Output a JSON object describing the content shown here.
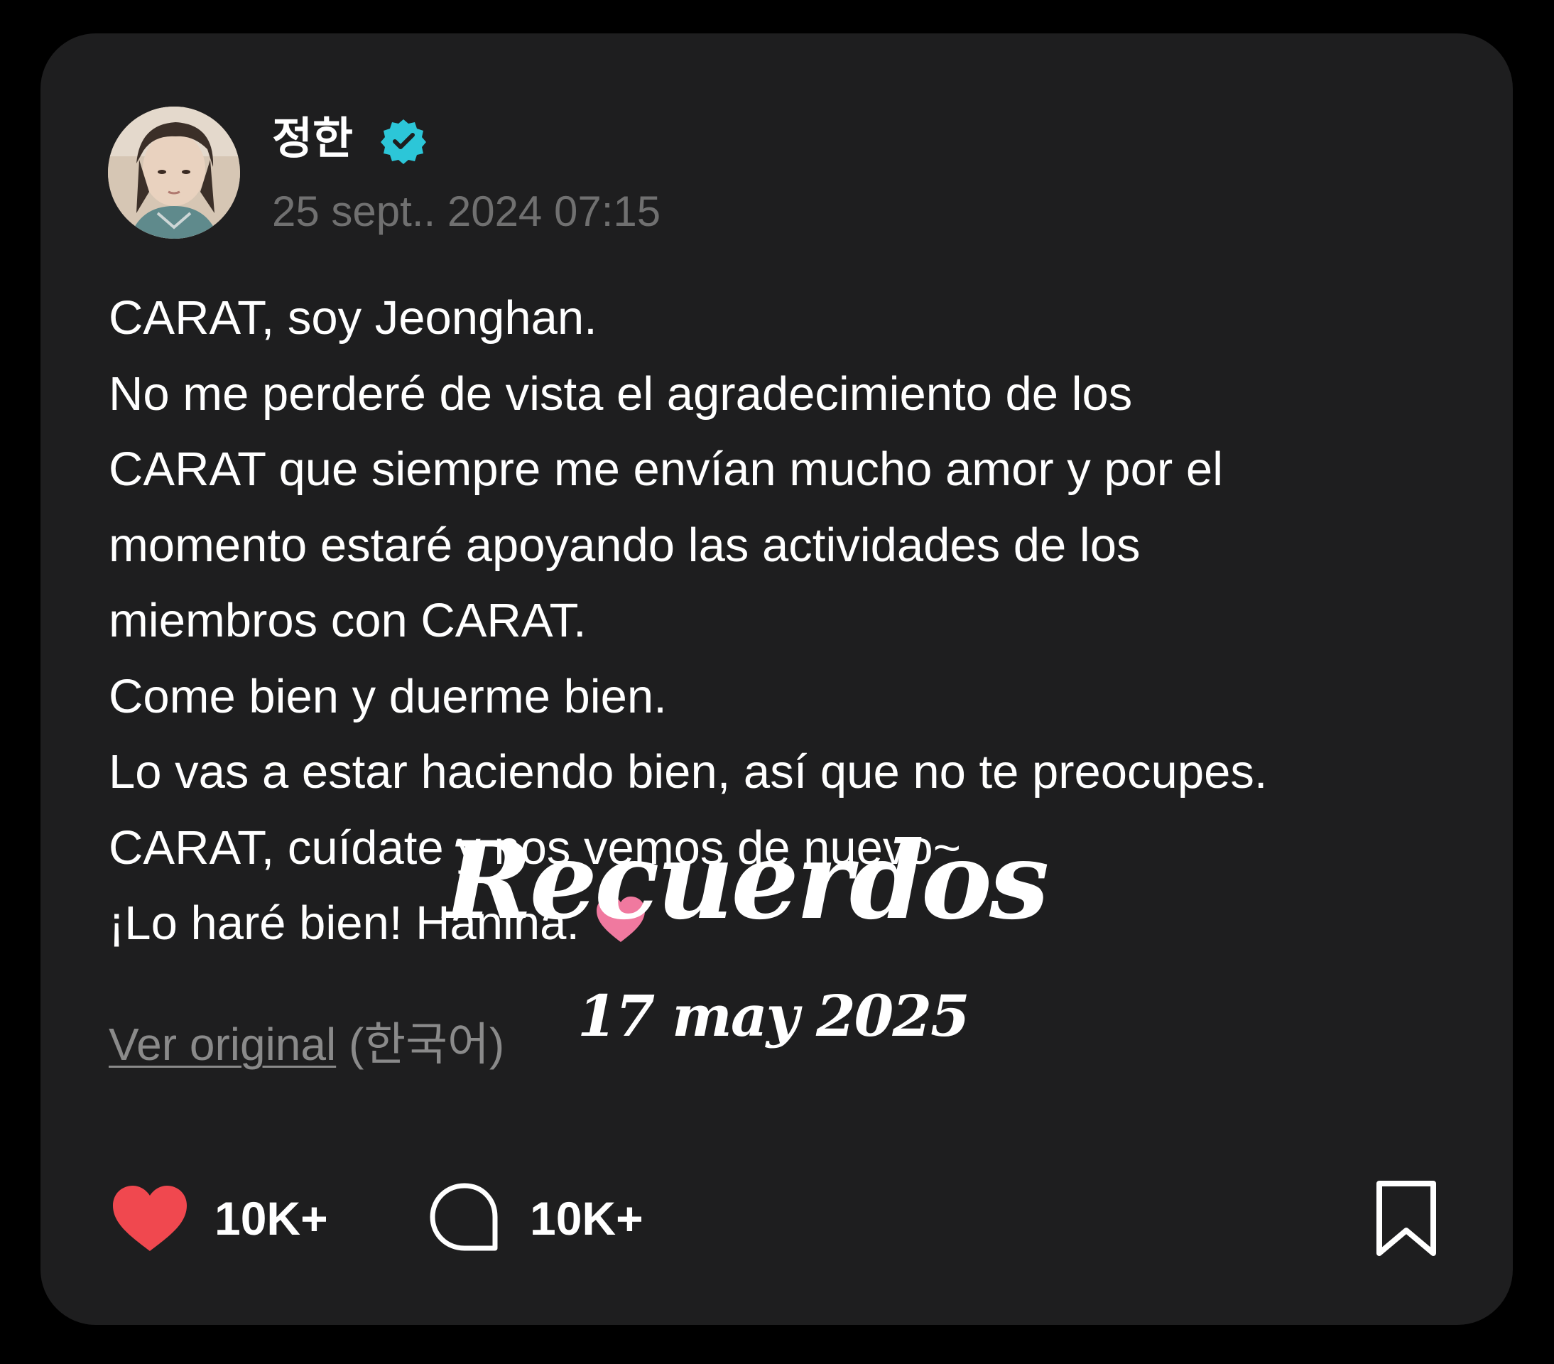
{
  "post": {
    "username": "정한",
    "verified": true,
    "timestamp": "25 sept.. 2024 07:15",
    "body_lines": [
      "CARAT, soy Jeonghan.",
      "No me perderé de vista el agradecimiento de los",
      "CARAT que siempre me envían mucho amor y por el",
      "momento estaré apoyando las actividades de los",
      "miembros con CARAT.",
      "Come bien y duerme bien.",
      "Lo vas a estar haciendo bien, así que no te preocupes.",
      "CARAT, cuídate y nos vemos de nuevo~",
      "¡Lo haré bien! Hanina."
    ],
    "view_original_link": "Ver original",
    "view_original_lang": " (한국어)"
  },
  "actions": {
    "like_count": "10K+",
    "comment_count": "10K+"
  },
  "overlay": {
    "title": "Recuerdos",
    "date": "17 may 2025"
  },
  "colors": {
    "background": "#000000",
    "card": "#1e1e1f",
    "verified_badge": "#2cc6d8",
    "like_heart": "#f0484f",
    "emoji_heart": "#f0799f"
  },
  "icons": {
    "verified": "verified-badge-icon",
    "emoji": "pink-heart-emoji-icon",
    "like": "heart-icon",
    "comment": "comment-bubble-icon",
    "bookmark": "bookmark-icon"
  }
}
